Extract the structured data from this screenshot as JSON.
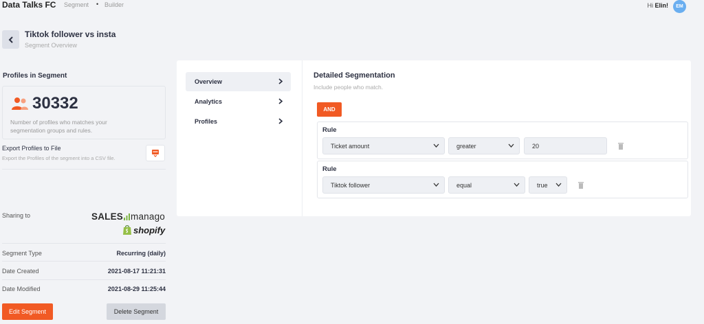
{
  "header": {
    "brand": "Data Talks FC",
    "crumb_segment": "Segment",
    "crumb_dot": "•",
    "crumb_builder": "Builder",
    "greeting_prefix": "Hi ",
    "user_name": "Elin!",
    "avatar_initials": "EM"
  },
  "page": {
    "title": "Tiktok follower vs insta",
    "subtitle": "Segment Overview"
  },
  "profiles": {
    "section_title": "Profiles in Segment",
    "count": "30332",
    "description": "Number of profiles who matches your segmentation groups and rules.",
    "export_label": "Export Profiles to File",
    "export_sub": "Export the Profiles of the segment into a CSV file."
  },
  "sharing": {
    "label": "Sharing to",
    "salesmanago_sales": "SALES",
    "salesmanago_manago": "manago",
    "shopify": "shopify"
  },
  "info": {
    "segment_type_label": "Segment Type",
    "segment_type_value": "Recurring (daily)",
    "date_created_label": "Date Created",
    "date_created_value": "2021-08-17 11:21:31",
    "date_modified_label": "Date Modified",
    "date_modified_value": "2021-08-29 11:25:44"
  },
  "actions": {
    "edit": "Edit Segment",
    "delete": "Delete Segment"
  },
  "nav": {
    "items": [
      {
        "label": "Overview",
        "active": true
      },
      {
        "label": "Analytics",
        "active": false
      },
      {
        "label": "Profiles",
        "active": false
      }
    ]
  },
  "segmentation": {
    "title": "Detailed Segmentation",
    "subtitle": "Include people who match.",
    "operator": "AND",
    "rules": [
      {
        "label": "Rule",
        "field": "Ticket amount",
        "comparator": "greater",
        "value": "20"
      },
      {
        "label": "Rule",
        "field": "Tiktok follower",
        "comparator": "equal",
        "value": "true"
      }
    ]
  },
  "colors": {
    "accent": "#f15a24",
    "avatar": "#6aaef0",
    "panel_bg": "#ffffff",
    "page_bg": "#f2f3f6"
  }
}
